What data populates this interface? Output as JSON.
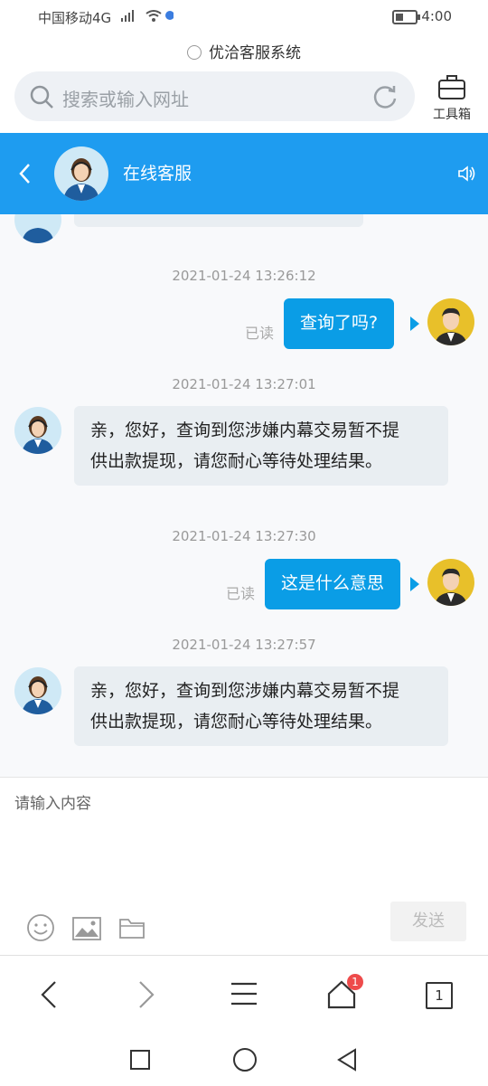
{
  "status_bar": {
    "carrier": "中国移动4G",
    "time": "4:00"
  },
  "browser": {
    "site_title": "优洽客服系统",
    "search_placeholder": "搜索或输入网址",
    "toolbox_label": "工具箱"
  },
  "chat_header": {
    "title": "在线客服"
  },
  "messages": [
    {
      "timestamp": "2021-01-24 13:26:12",
      "direction": "out",
      "text": "查询了吗?",
      "read": "已读"
    },
    {
      "timestamp": "2021-01-24 13:27:01",
      "direction": "in",
      "lines": [
        "亲，您好，查询到您涉嫌内幕交易暂不提",
        "供出款提现，请您耐心等待处理结果。"
      ]
    },
    {
      "timestamp": "2021-01-24 13:27:30",
      "direction": "out",
      "text": "这是什么意思",
      "read": "已读"
    },
    {
      "timestamp": "2021-01-24 13:27:57",
      "direction": "in",
      "lines": [
        "亲，您好，查询到您涉嫌内幕交易暂不提",
        "供出款提现，请您耐心等待处理结果。"
      ]
    }
  ],
  "composer": {
    "placeholder": "请输入内容",
    "send_label": "发送"
  },
  "bottom_nav": {
    "home_badge": "1",
    "tab_count": "1"
  },
  "colors": {
    "header": "#1e9cf0",
    "out_bubble": "#0a9de6",
    "in_bubble": "#e9eef2",
    "badge": "#ee4b4b"
  }
}
